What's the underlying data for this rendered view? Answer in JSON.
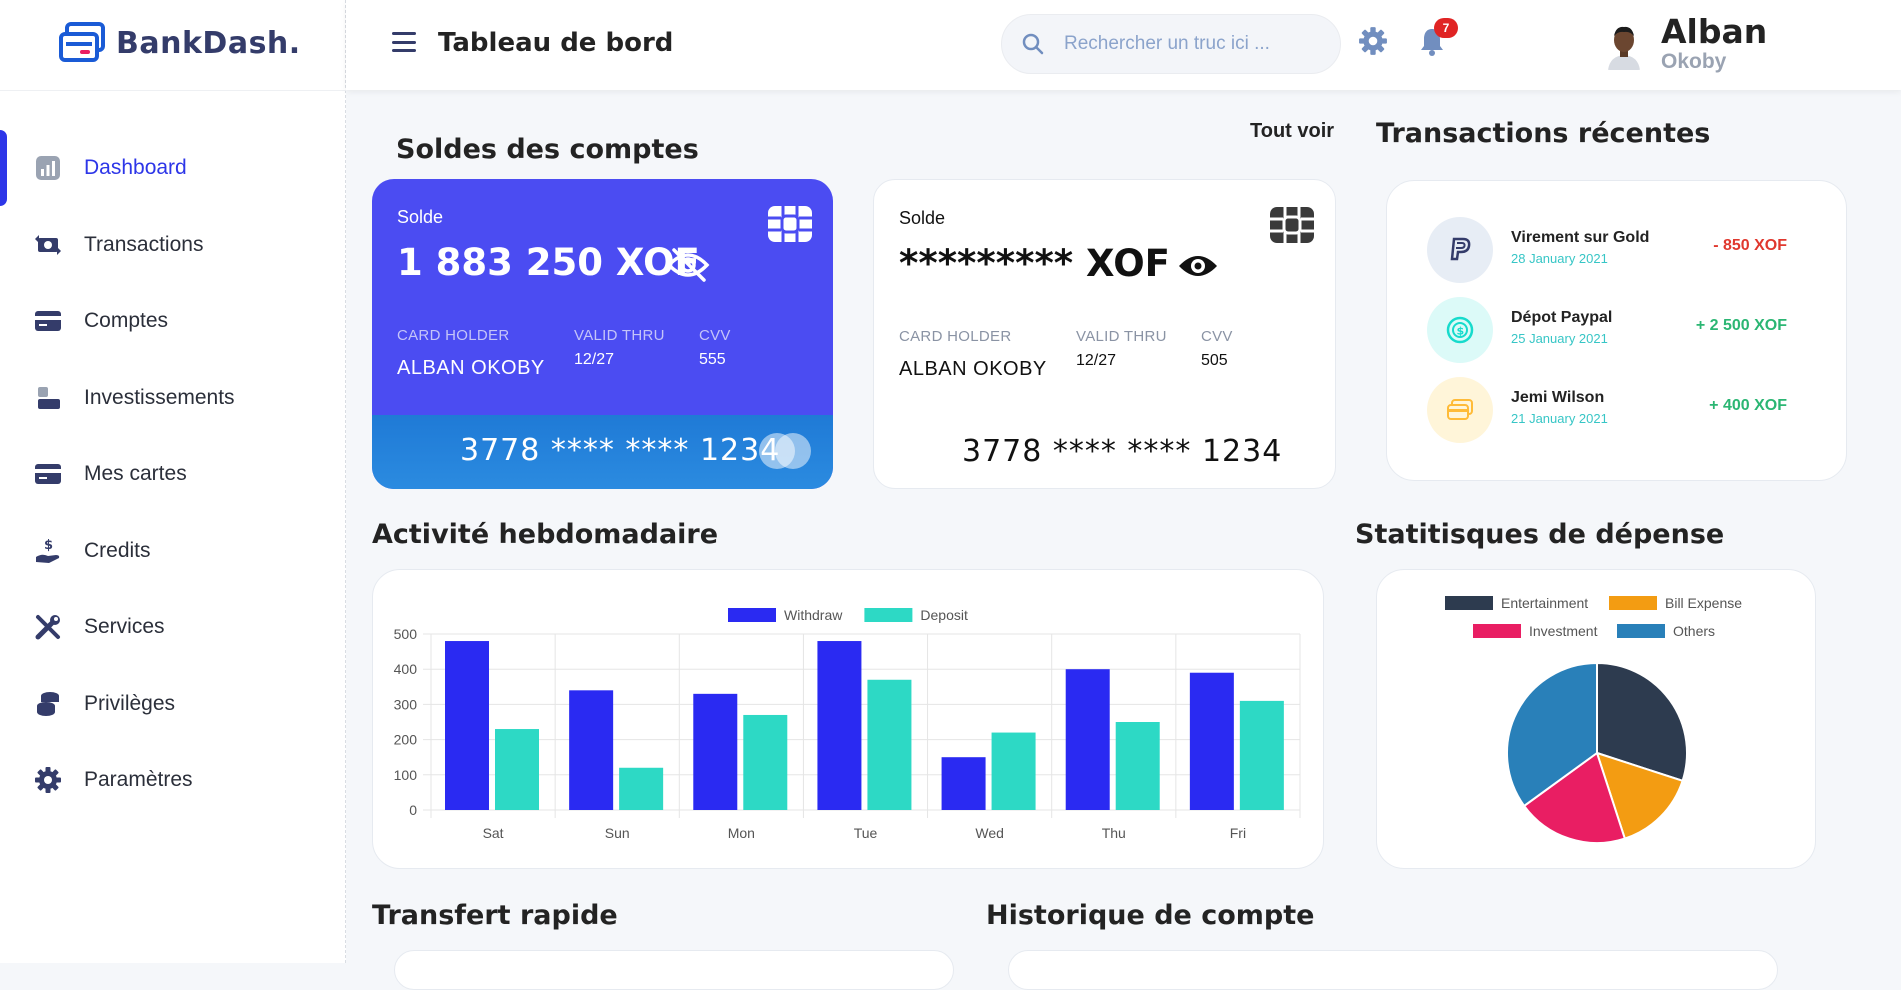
{
  "app": {
    "brand": "BankDash."
  },
  "sidebar": {
    "items": [
      {
        "label": "Dashboard",
        "icon": "dashboard-chart-icon",
        "active": true
      },
      {
        "label": "Transactions",
        "icon": "transfer-money-icon"
      },
      {
        "label": "Comptes",
        "icon": "credit-card-icon"
      },
      {
        "label": "Investissements",
        "icon": "investment-icon"
      },
      {
        "label": "Mes cartes",
        "icon": "credit-card-icon"
      },
      {
        "label": "Credits",
        "icon": "hand-dollar-icon"
      },
      {
        "label": "Services",
        "icon": "tools-icon"
      },
      {
        "label": "Privilèges",
        "icon": "coins-icon"
      },
      {
        "label": "Paramètres",
        "icon": "gear-icon"
      }
    ]
  },
  "header": {
    "title": "Tableau de bord",
    "search_placeholder": "Rechercher un truc ici ...",
    "notification_count": "7",
    "user_first": "Alban",
    "user_last": "Okoby"
  },
  "accounts": {
    "title": "Soldes des comptes",
    "see_all": "Tout voir",
    "cards": [
      {
        "label": "Solde",
        "balance": "1 883 250 XOF",
        "holder_label": "CARD HOLDER",
        "holder": "ALBAN OKOBY",
        "valid_label": "VALID THRU",
        "valid": "12/27",
        "cvv_label": "CVV",
        "cvv": "555",
        "number": "3778 **** **** 1234"
      },
      {
        "label": "Solde",
        "balance": "********* XOF",
        "holder_label": "CARD HOLDER",
        "holder": "ALBAN OKOBY",
        "valid_label": "VALID THRU",
        "valid": "12/27",
        "cvv_label": "CVV",
        "cvv": "505",
        "number": "3778 **** **** 1234"
      }
    ]
  },
  "recent": {
    "title": "Transactions récentes",
    "items": [
      {
        "title": "Virement sur Gold",
        "date": "28 January 2021",
        "amount": "- 850 XOF",
        "color": "#e0382e",
        "icon": "paypal-icon",
        "bg": "#e7edf5"
      },
      {
        "title": "Dépot Paypal",
        "date": "25 January 2021",
        "amount": "+ 2 500 XOF",
        "color": "#2bb673",
        "icon": "coin-icon",
        "bg": "#dcfaf8"
      },
      {
        "title": "Jemi Wilson",
        "date": "21 January 2021",
        "amount": "+ 400 XOF",
        "color": "#2bb673",
        "icon": "card-icon",
        "bg": "#fff5d9"
      }
    ]
  },
  "weekly": {
    "title": "Activité hebdomadaire"
  },
  "expense": {
    "title": "Statitisques de dépense"
  },
  "transfer": {
    "title": "Transfert rapide"
  },
  "history": {
    "title": "Historique de compte"
  },
  "chart_data": [
    {
      "type": "bar",
      "categories": [
        "Sat",
        "Sun",
        "Mon",
        "Tue",
        "Wed",
        "Thu",
        "Fri"
      ],
      "series": [
        {
          "name": "Withdraw",
          "values": [
            480,
            340,
            330,
            480,
            150,
            400,
            390
          ],
          "color": "#2a2af2"
        },
        {
          "name": "Deposit",
          "values": [
            230,
            120,
            270,
            370,
            220,
            250,
            310
          ],
          "color": "#2dd9c5"
        }
      ],
      "ylim": [
        0,
        500
      ],
      "yticks": [
        0,
        100,
        200,
        300,
        400,
        500
      ],
      "legend": "top-center",
      "grid": true
    },
    {
      "type": "pie",
      "labels": [
        "Entertainment",
        "Bill Expense",
        "Investment",
        "Others"
      ],
      "values": [
        30,
        15,
        20,
        35
      ],
      "colors": [
        "#2d3b4f",
        "#f39c12",
        "#e91e63",
        "#2980b9"
      ],
      "legend": "top"
    }
  ]
}
